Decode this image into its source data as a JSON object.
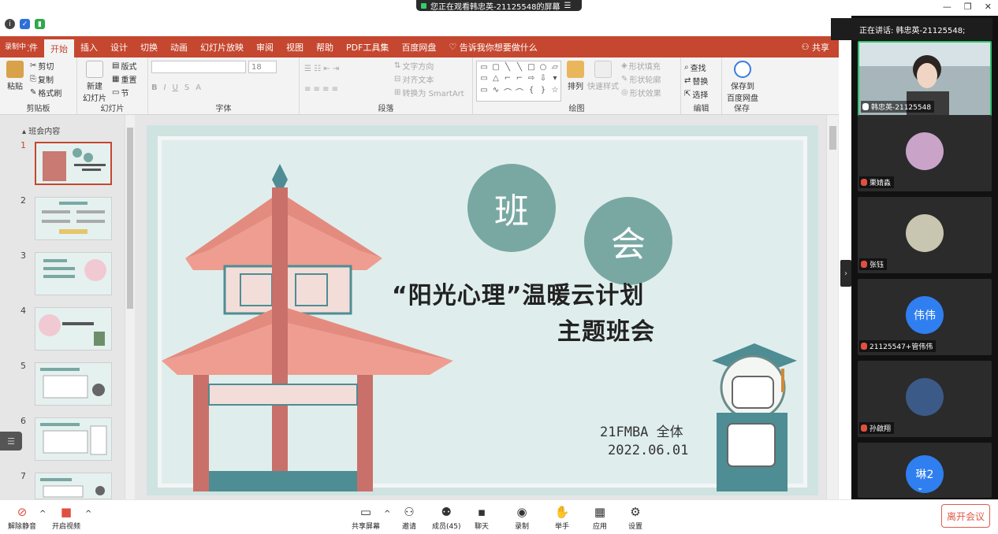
{
  "banner": {
    "text": "您正在观看韩忠英-21125548的屏幕"
  },
  "window_controls": {
    "minimize": "—",
    "restore": "❐",
    "close": "✕"
  },
  "ppt": {
    "file_tab": "文件",
    "recording": "录制中",
    "tabs": [
      "开始",
      "插入",
      "设计",
      "切换",
      "动画",
      "幻灯片放映",
      "审阅",
      "视图",
      "帮助",
      "PDF工具集",
      "百度网盘"
    ],
    "active_tab": "开始",
    "tell_me": "告诉我你想要做什么",
    "share": "共享",
    "ribbon": {
      "clipboard": {
        "paste": "粘贴",
        "cut": "剪切",
        "copy": "复制",
        "format_painter": "格式刷",
        "label": "剪贴板"
      },
      "slides": {
        "new_slide": "新建\n幻灯片",
        "layout": "版式",
        "reset": "重置",
        "section": "节",
        "label": "幻灯片"
      },
      "font": {
        "size": "18",
        "label": "字体"
      },
      "paragraph": {
        "text_direction": "文字方向",
        "align_text": "对齐文本",
        "smartart": "转换为 SmartArt",
        "label": "段落"
      },
      "drawing": {
        "arrange": "排列",
        "quick_styles": "快速样式",
        "fill": "形状填充",
        "outline": "形状轮廓",
        "effects": "形状效果",
        "label": "绘图"
      },
      "editing": {
        "find": "查找",
        "replace": "替换",
        "select": "选择",
        "label": "编辑"
      },
      "save": {
        "save_baidu": "保存到\n百度网盘",
        "label": "保存"
      }
    },
    "section_name": "班会内容",
    "thumbnails": [
      1,
      2,
      3,
      4,
      5,
      6,
      7
    ],
    "selected_slide": 1,
    "slide": {
      "char1": "班",
      "char2": "会",
      "title1": "“阳光心理”温暖云计划",
      "title2": "主题班会",
      "class": "21FMBA 全体",
      "date": "2022.06.01"
    }
  },
  "meeting": {
    "speaking": "正在讲话: 韩忠英-21125548;",
    "participants": [
      {
        "name": "韩忠英-21125548",
        "muted": false
      },
      {
        "name": "栗婧淼",
        "muted": true
      },
      {
        "name": "张钰",
        "muted": true
      },
      {
        "name": "21125547+管伟伟",
        "muted": true,
        "avatar_text": "伟伟"
      },
      {
        "name": "孙啟翔",
        "muted": true
      },
      {
        "name": "琳2",
        "muted": true,
        "avatar_text": "琳2"
      }
    ],
    "toolbar": {
      "unmute": "解除静音",
      "start_video": "开启视频",
      "share_screen": "共享屏幕",
      "invite": "邀请",
      "members": "成员(45)",
      "chat": "聊天",
      "record": "录制",
      "raise_hand": "举手",
      "apps": "应用",
      "settings": "设置",
      "leave": "离开会议"
    }
  }
}
